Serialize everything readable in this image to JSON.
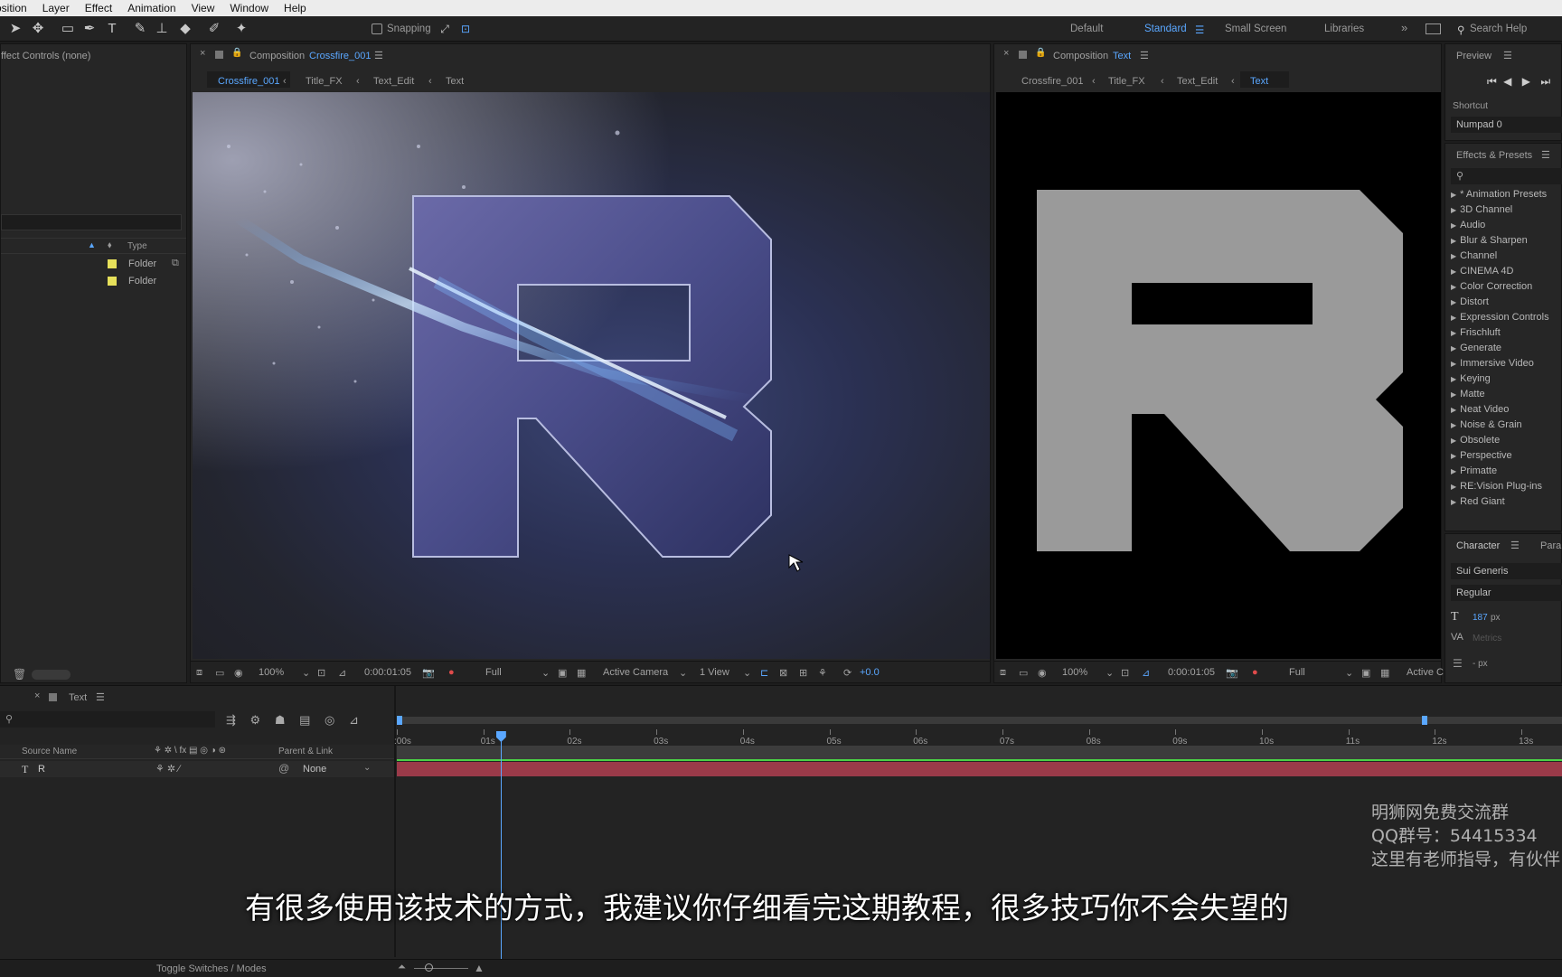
{
  "menu": [
    "osition",
    "Layer",
    "Effect",
    "Animation",
    "View",
    "Window",
    "Help"
  ],
  "toolbar": {
    "snapping": "Snapping",
    "workspaces": [
      "Default",
      "Standard",
      "Small Screen",
      "Libraries"
    ],
    "search": "Search Help"
  },
  "left_panel": {
    "title": "ffect Controls (none)",
    "col_type": "Type",
    "rows": [
      {
        "type": "Folder"
      },
      {
        "type": "Folder"
      }
    ]
  },
  "comp_main": {
    "tab_prefix": "Composition",
    "tab_name": "Crossfire_001",
    "crumbs": [
      "Crossfire_001",
      "Title_FX",
      "Text_Edit",
      "Text"
    ],
    "active_crumb": 0,
    "zoom": "100%",
    "timecode": "0:00:01:05",
    "resolution": "Full",
    "camera": "Active Camera",
    "views": "1 View",
    "exposure": "+0.0"
  },
  "comp_text": {
    "tab_prefix": "Composition",
    "tab_name": "Text",
    "crumbs": [
      "Crossfire_001",
      "Title_FX",
      "Text_Edit",
      "Text"
    ],
    "active_crumb": 3,
    "zoom": "100%",
    "timecode": "0:00:01:05",
    "resolution": "Full",
    "camera": "Active C"
  },
  "right": {
    "preview_title": "Preview",
    "shortcut_label": "Shortcut",
    "shortcut_value": "Numpad 0",
    "effects_title": "Effects & Presets",
    "effects": [
      "* Animation Presets",
      "3D Channel",
      "Audio",
      "Blur & Sharpen",
      "Channel",
      "CINEMA 4D",
      "Color Correction",
      "Distort",
      "Expression Controls",
      "Frischluft",
      "Generate",
      "Immersive Video",
      "Keying",
      "Matte",
      "Neat Video",
      "Noise & Grain",
      "Obsolete",
      "Perspective",
      "Primatte",
      "RE:Vision Plug-ins",
      "Red Giant"
    ],
    "character_title": "Character",
    "para_title": "Para",
    "font": "Sui Generis",
    "style": "Regular",
    "size": "187",
    "size_unit": "px",
    "kerning": "Metrics",
    "leading_unit": "- px"
  },
  "timeline": {
    "tab": "Text",
    "col_source": "Source Name",
    "col_parent": "Parent & Link",
    "layer_name": "R",
    "parent": "None",
    "ticks": [
      ":00s",
      "01s",
      "02s",
      "03s",
      "04s",
      "05s",
      "06s",
      "07s",
      "08s",
      "09s",
      "10s",
      "11s",
      "12s",
      "13s"
    ],
    "toggle": "Toggle Switches / Modes",
    "playhead_time_sec": 1.2
  },
  "subtitle": "有很多使用该技术的方式，我建议你仔细看完这期教程，很多技巧你不会失望的",
  "watermark": [
    "明狮网免费交流群",
    "QQ群号：54415334",
    "这里有老师指导，有伙伴"
  ],
  "colors": {
    "accent": "#5aa7ff",
    "folder": "#e6e05a",
    "layer_bar": "#9a3a49",
    "green_line": "#4bd146"
  }
}
